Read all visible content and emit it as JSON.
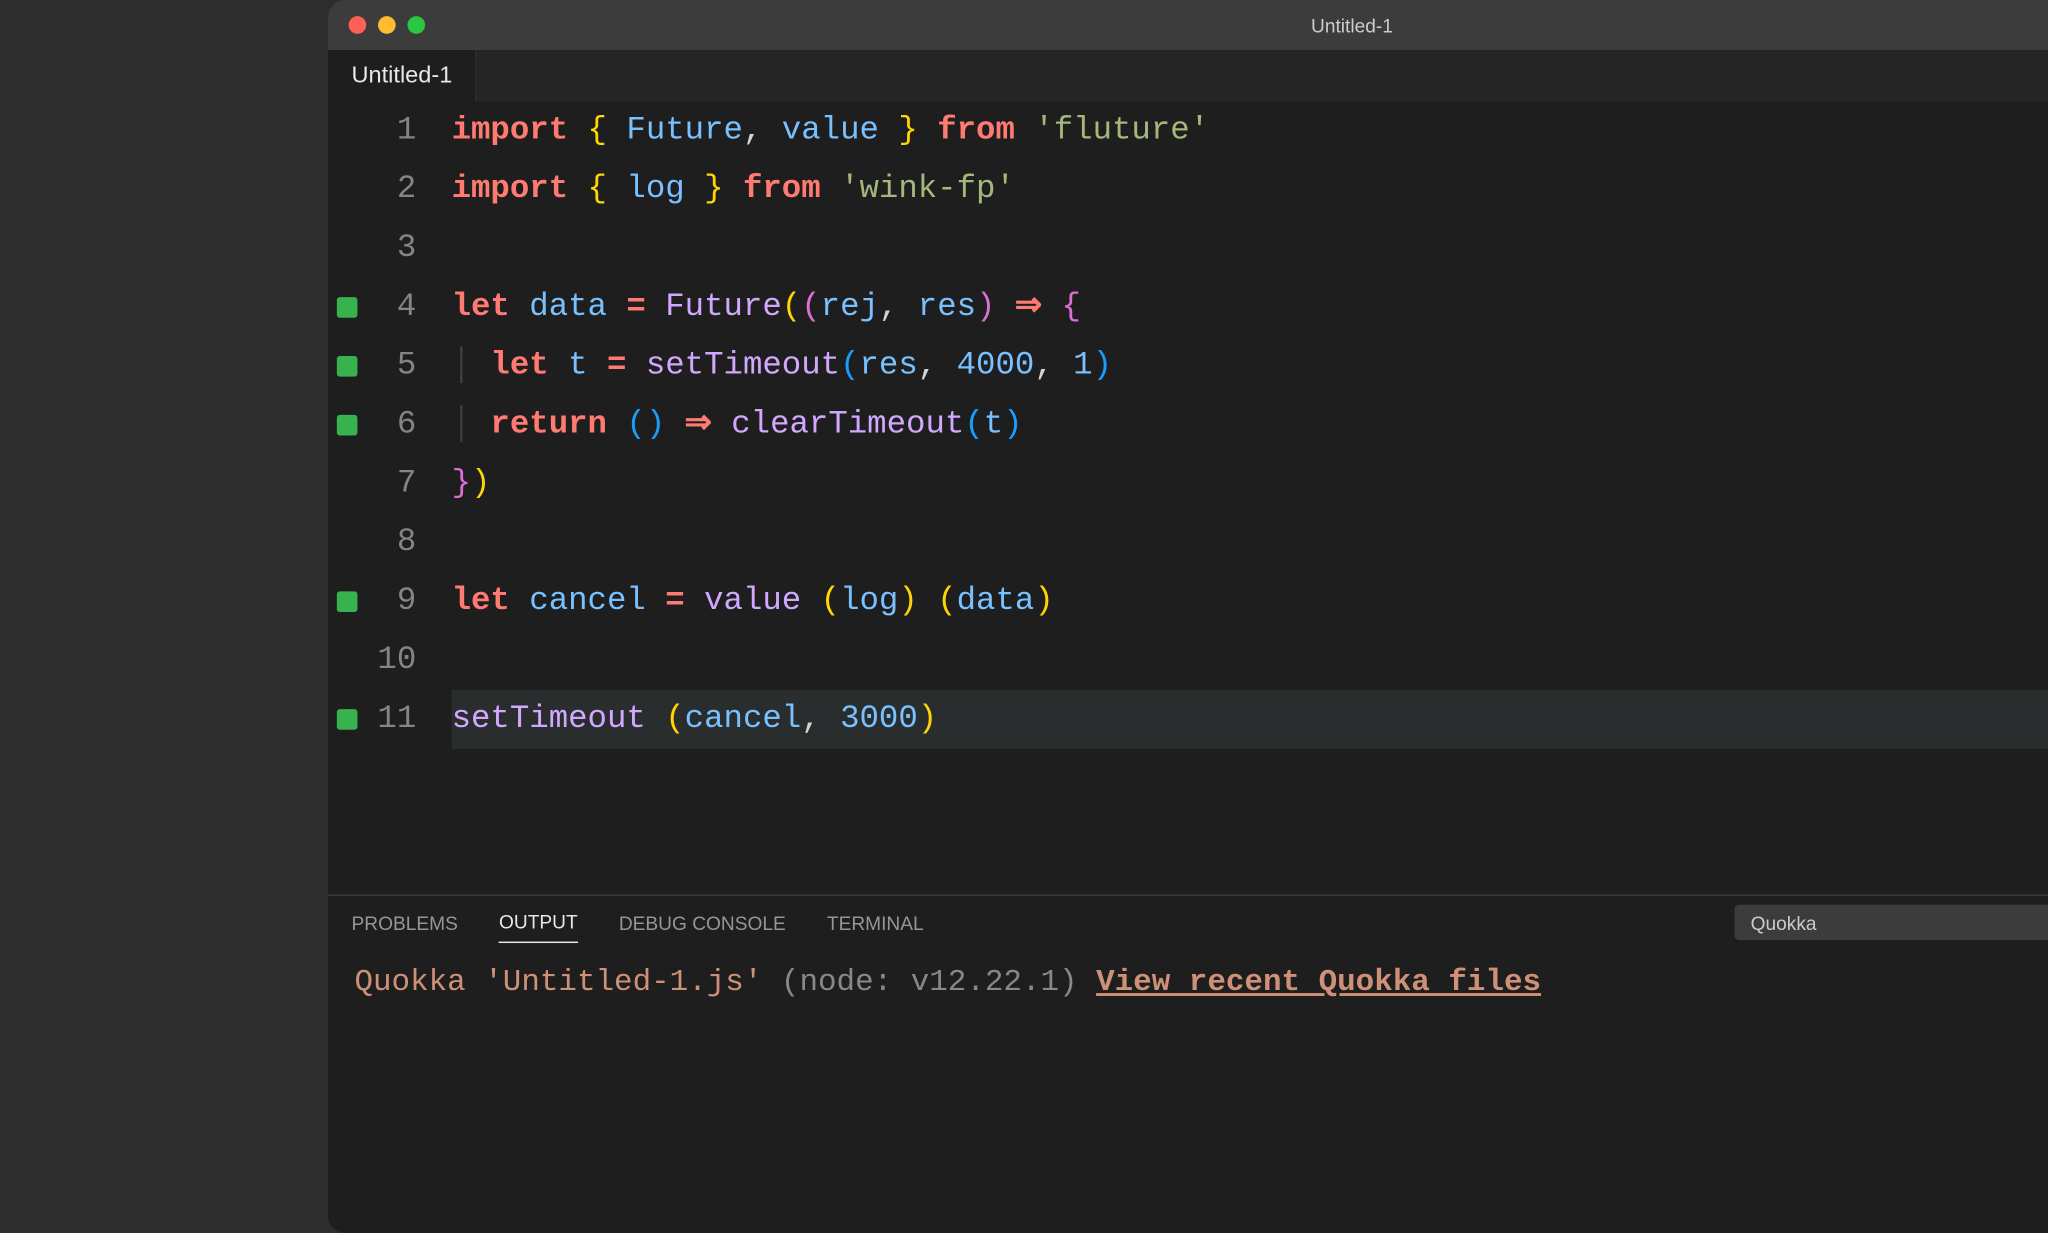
{
  "window": {
    "title": "Untitled-1"
  },
  "tabs": {
    "active": "Untitled-1"
  },
  "editor": {
    "lines": [
      {
        "n": 1,
        "marker": false,
        "tokens": [
          {
            "c": "kw",
            "t": "import"
          },
          {
            "c": "plain",
            "t": " "
          },
          {
            "c": "paren-y",
            "t": "{"
          },
          {
            "c": "plain",
            "t": " "
          },
          {
            "c": "ident-blue",
            "t": "Future"
          },
          {
            "c": "plain",
            "t": ", "
          },
          {
            "c": "ident-blue",
            "t": "value"
          },
          {
            "c": "plain",
            "t": " "
          },
          {
            "c": "paren-y",
            "t": "}"
          },
          {
            "c": "plain",
            "t": " "
          },
          {
            "c": "kw",
            "t": "from"
          },
          {
            "c": "plain",
            "t": " "
          },
          {
            "c": "str2",
            "t": "'fluture'"
          }
        ]
      },
      {
        "n": 2,
        "marker": false,
        "tokens": [
          {
            "c": "kw",
            "t": "import"
          },
          {
            "c": "plain",
            "t": " "
          },
          {
            "c": "paren-y",
            "t": "{"
          },
          {
            "c": "plain",
            "t": " "
          },
          {
            "c": "ident-blue",
            "t": "log"
          },
          {
            "c": "plain",
            "t": " "
          },
          {
            "c": "paren-y",
            "t": "}"
          },
          {
            "c": "plain",
            "t": " "
          },
          {
            "c": "kw",
            "t": "from"
          },
          {
            "c": "plain",
            "t": " "
          },
          {
            "c": "str2",
            "t": "'wink-fp'"
          }
        ]
      },
      {
        "n": 3,
        "marker": false,
        "tokens": []
      },
      {
        "n": 4,
        "marker": true,
        "tokens": [
          {
            "c": "kw",
            "t": "let"
          },
          {
            "c": "plain",
            "t": " "
          },
          {
            "c": "ident-blue",
            "t": "data"
          },
          {
            "c": "plain",
            "t": " "
          },
          {
            "c": "kw",
            "t": "="
          },
          {
            "c": "plain",
            "t": " "
          },
          {
            "c": "fn",
            "t": "Future"
          },
          {
            "c": "paren-y",
            "t": "("
          },
          {
            "c": "paren-p",
            "t": "("
          },
          {
            "c": "ident-blue",
            "t": "rej"
          },
          {
            "c": "plain",
            "t": ", "
          },
          {
            "c": "ident-blue",
            "t": "res"
          },
          {
            "c": "paren-p",
            "t": ")"
          },
          {
            "c": "plain",
            "t": " "
          },
          {
            "c": "arrow",
            "t": "⇒"
          },
          {
            "c": "plain",
            "t": " "
          },
          {
            "c": "paren-p",
            "t": "{"
          }
        ]
      },
      {
        "n": 5,
        "marker": true,
        "indent": true,
        "tokens": [
          {
            "c": "kw",
            "t": "let"
          },
          {
            "c": "plain",
            "t": " "
          },
          {
            "c": "ident-blue",
            "t": "t"
          },
          {
            "c": "plain",
            "t": " "
          },
          {
            "c": "kw",
            "t": "="
          },
          {
            "c": "plain",
            "t": " "
          },
          {
            "c": "fn",
            "t": "setTimeout"
          },
          {
            "c": "paren-b",
            "t": "("
          },
          {
            "c": "ident-blue",
            "t": "res"
          },
          {
            "c": "plain",
            "t": ", "
          },
          {
            "c": "num",
            "t": "4000"
          },
          {
            "c": "plain",
            "t": ", "
          },
          {
            "c": "num",
            "t": "1"
          },
          {
            "c": "paren-b",
            "t": ")"
          }
        ]
      },
      {
        "n": 6,
        "marker": true,
        "indent": true,
        "tokens": [
          {
            "c": "kw",
            "t": "return"
          },
          {
            "c": "plain",
            "t": " "
          },
          {
            "c": "paren-b",
            "t": "("
          },
          {
            "c": "paren-b",
            "t": ")"
          },
          {
            "c": "plain",
            "t": " "
          },
          {
            "c": "arrow",
            "t": "⇒"
          },
          {
            "c": "plain",
            "t": " "
          },
          {
            "c": "fn",
            "t": "clearTimeout"
          },
          {
            "c": "paren-b",
            "t": "("
          },
          {
            "c": "ident-blue",
            "t": "t"
          },
          {
            "c": "paren-b",
            "t": ")"
          }
        ]
      },
      {
        "n": 7,
        "marker": false,
        "tokens": [
          {
            "c": "paren-p",
            "t": "}"
          },
          {
            "c": "paren-y",
            "t": ")"
          }
        ]
      },
      {
        "n": 8,
        "marker": false,
        "tokens": []
      },
      {
        "n": 9,
        "marker": true,
        "tokens": [
          {
            "c": "kw",
            "t": "let"
          },
          {
            "c": "plain",
            "t": " "
          },
          {
            "c": "ident-blue",
            "t": "cancel"
          },
          {
            "c": "plain",
            "t": " "
          },
          {
            "c": "kw",
            "t": "="
          },
          {
            "c": "plain",
            "t": " "
          },
          {
            "c": "fn",
            "t": "value"
          },
          {
            "c": "plain",
            "t": " "
          },
          {
            "c": "paren-y",
            "t": "("
          },
          {
            "c": "ident-blue",
            "t": "log"
          },
          {
            "c": "paren-y",
            "t": ")"
          },
          {
            "c": "plain",
            "t": " "
          },
          {
            "c": "paren-y",
            "t": "("
          },
          {
            "c": "ident-blue",
            "t": "data"
          },
          {
            "c": "paren-y",
            "t": ")"
          }
        ]
      },
      {
        "n": 10,
        "marker": false,
        "tokens": []
      },
      {
        "n": 11,
        "marker": true,
        "highlight": true,
        "tokens": [
          {
            "c": "fn",
            "t": "setTimeout"
          },
          {
            "c": "plain",
            "t": " "
          },
          {
            "c": "paren-y",
            "t": "("
          },
          {
            "c": "ident-blue",
            "t": "cancel"
          },
          {
            "c": "plain",
            "t": ", "
          },
          {
            "c": "num",
            "t": "3000"
          },
          {
            "c": "paren-y",
            "t": ")"
          }
        ]
      }
    ]
  },
  "panel": {
    "tabs": [
      "PROBLEMS",
      "OUTPUT",
      "DEBUG CONSOLE",
      "TERMINAL"
    ],
    "active": "OUTPUT",
    "dropdown": "Quokka",
    "output_prefix": "Quokka ",
    "output_file": "'Untitled-1.js'",
    "output_node": " (node: v12.22.1) ",
    "output_link": "View recent Quokka files"
  }
}
